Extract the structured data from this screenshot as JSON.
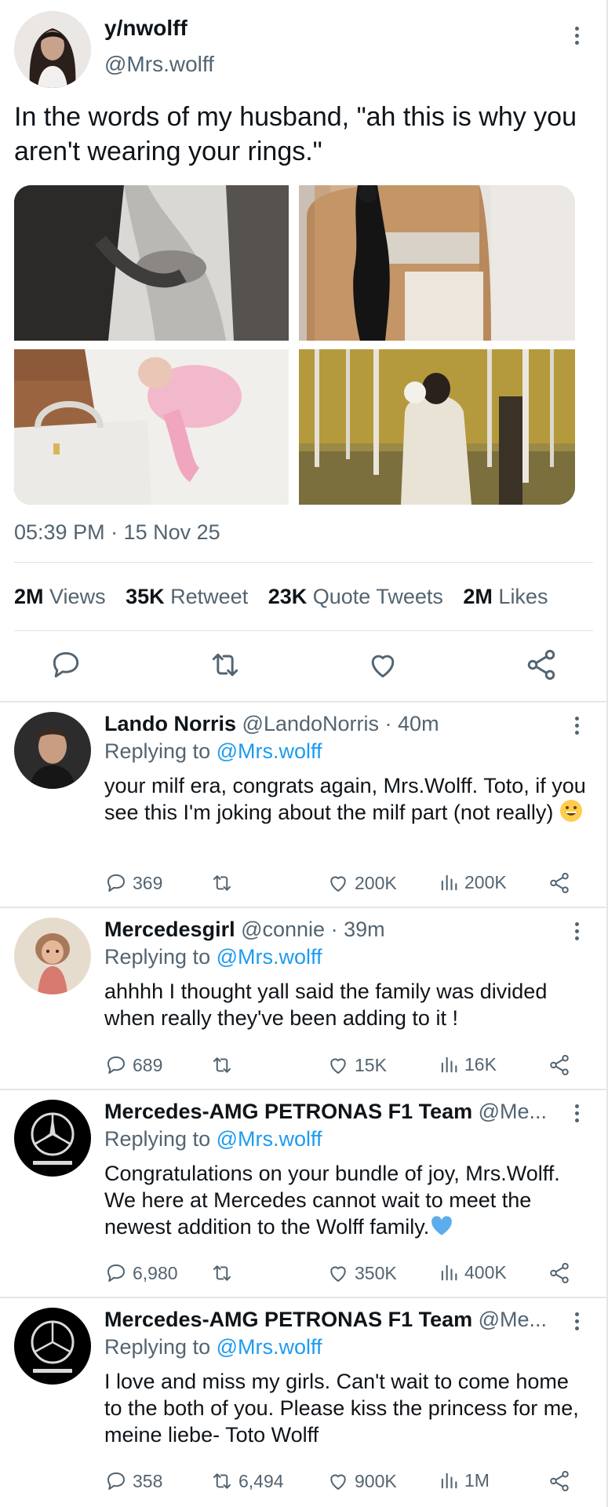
{
  "tweet": {
    "name": "y/nwolff",
    "handle": "@Mrs.wolff",
    "text": "In the words of my husband, \"ah this is why you aren't wearing your rings.\"",
    "timestamp": "05:39 PM · 15 Nov 25",
    "stats": [
      {
        "value": "2M",
        "label": "Views"
      },
      {
        "value": "35K",
        "label": "Retweet"
      },
      {
        "value": "23K",
        "label": "Quote Tweets"
      },
      {
        "value": "2M",
        "label": "Likes"
      }
    ],
    "actions": [
      "reply-icon",
      "retweet-icon",
      "like-icon",
      "share-icon"
    ]
  },
  "replies": [
    {
      "name": "Lando Norris",
      "handle": "@LandoNorris",
      "time": "· 40m",
      "replying_prefix": "Replying to",
      "replying_to": "@Mrs.wolff",
      "text": "your milf era, congrats again, Mrs.Wolff. Toto, if you see this I'm joking about the milf part (not really)",
      "emoji": "grinning-face-emoji",
      "replies": "369",
      "retweets": "",
      "likes": "200K",
      "views": "200K"
    },
    {
      "name": "Mercedesgirl",
      "handle": "@connie",
      "time": "· 39m",
      "replying_prefix": "Replying to",
      "replying_to": "@Mrs.wolff",
      "text": "ahhhh I thought yall said the family was divided when really they've been adding to it !",
      "replies": "689",
      "retweets": "",
      "likes": "15K",
      "views": "16K"
    },
    {
      "name": "Mercedes-AMG PETRONAS F1 Team",
      "handle": "@Me...",
      "time": "",
      "replying_prefix": "Replying to",
      "replying_to": "@Mrs.wolff",
      "text": "Congratulations on your bundle of joy, Mrs.Wolff. We here at Mercedes cannot wait to meet the newest addition to the Wolff family.",
      "emoji": "blue-heart-emoji",
      "replies": "6,980",
      "retweets": "",
      "likes": "350K",
      "views": "400K"
    },
    {
      "name": "Mercedes-AMG PETRONAS F1 Team",
      "handle": "@Me...",
      "time": "",
      "replying_prefix": "Replying to",
      "replying_to": "@Mrs.wolff",
      "text": "I love and miss my girls. Can't wait to come home to the both of you. Please kiss the princess for me, meine liebe- Toto Wolff",
      "replies": "358",
      "retweets": "6,494",
      "likes": "900K",
      "views": "1M"
    }
  ],
  "colors": {
    "accent": "#1d9bf0",
    "muted": "#536471",
    "text": "#0f1419"
  }
}
